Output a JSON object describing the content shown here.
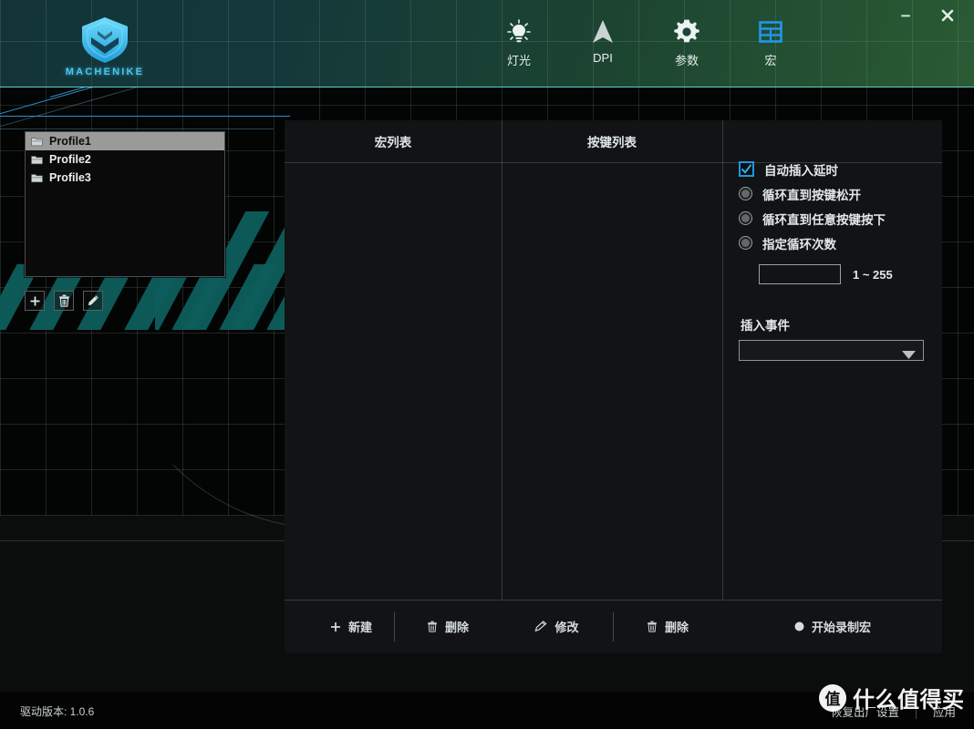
{
  "window": {
    "minimize_label": "—",
    "close_label": "✕"
  },
  "brand": {
    "logo_text": "MACHENIKE",
    "logo_color": "#49c8ef"
  },
  "nav": {
    "items": [
      {
        "label": "灯光",
        "icon": "lightbulb-icon",
        "active": false
      },
      {
        "label": "DPI",
        "icon": "cursor-arrow-icon",
        "active": false
      },
      {
        "label": "参数",
        "icon": "gear-icon",
        "active": false
      },
      {
        "label": "宏",
        "icon": "macro-table-icon",
        "active": true
      }
    ],
    "active_color": "#2196e8"
  },
  "profiles": {
    "items": [
      {
        "label": "Profile1",
        "selected": true
      },
      {
        "label": "Profile2",
        "selected": false
      },
      {
        "label": "Profile3",
        "selected": false
      }
    ],
    "buttons": [
      {
        "name": "add-profile-button",
        "icon": "plus-icon"
      },
      {
        "name": "delete-profile-button",
        "icon": "trash-icon"
      },
      {
        "name": "rename-profile-button",
        "icon": "pencil-icon"
      }
    ]
  },
  "panel": {
    "columns": [
      {
        "title": "宏列表"
      },
      {
        "title": "按键列表"
      }
    ],
    "macro_list_items": [],
    "key_list_items": [],
    "toolbar": [
      {
        "label": "新建",
        "icon": "plus-icon"
      },
      {
        "label": "删除",
        "icon": "trash-icon"
      },
      {
        "label": "修改",
        "icon": "pencil-icon"
      },
      {
        "label": "删除",
        "icon": "trash-icon"
      },
      {
        "label": "开始录制宏",
        "icon": "record-dot-icon"
      }
    ]
  },
  "options": {
    "auto_delay": {
      "label": "自动插入延时",
      "checked": true
    },
    "loop_until_release": {
      "label": "循环直到按键松开",
      "checked": false
    },
    "loop_until_any_key": {
      "label": "循环直到任意按键按下",
      "checked": false
    },
    "loop_specified_times": {
      "label": "指定循环次数",
      "checked": false
    },
    "loop_count_value": "",
    "loop_count_hint": "1 ~ 255",
    "insert_event": {
      "label": "插入事件",
      "selected": "",
      "options": []
    }
  },
  "status": {
    "driver_version": "驱动版本: 1.0.6",
    "factory_reset": "恢复出厂设置",
    "apply": "应用"
  },
  "watermark": {
    "badge": "值",
    "text": "什么值得买"
  }
}
